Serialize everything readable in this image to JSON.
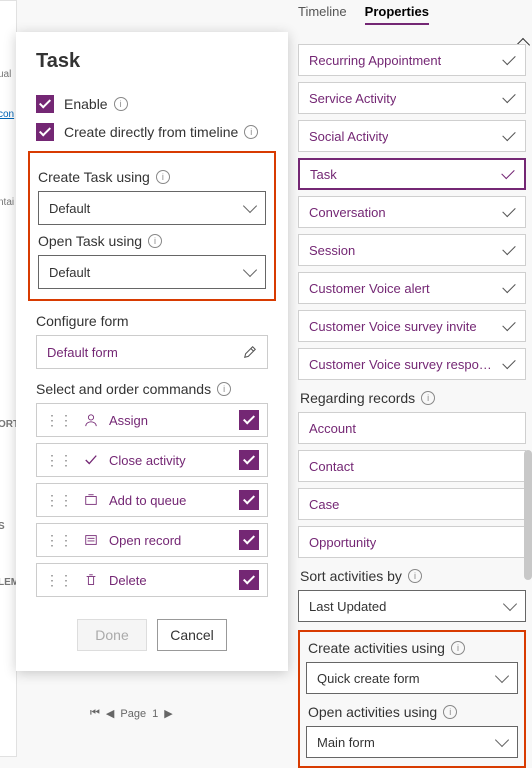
{
  "farLeft": {
    "a": "ual",
    "b": "con",
    "c": "ntai",
    "d": "ORTI",
    "e": "S",
    "f": "LEM"
  },
  "task": {
    "title": "Task",
    "enable_label": "Enable",
    "create_directly_label": "Create directly from timeline",
    "create_using_label": "Create Task using",
    "create_using_value": "Default",
    "open_using_label": "Open Task using",
    "open_using_value": "Default",
    "configure_form_label": "Configure form",
    "configure_form_value": "Default form",
    "commands_label": "Select and order commands",
    "cmds": [
      "Assign",
      "Close activity",
      "Add to queue",
      "Open record",
      "Delete"
    ],
    "done": "Done",
    "cancel": "Cancel"
  },
  "pager": {
    "label": "Page",
    "num": "1"
  },
  "tabs": {
    "timeline": "Timeline",
    "properties": "Properties"
  },
  "activities": [
    "Recurring Appointment",
    "Service Activity",
    "Social Activity",
    "Task",
    "Conversation",
    "Session",
    "Customer Voice alert",
    "Customer Voice survey invite",
    "Customer Voice survey response"
  ],
  "regarding": {
    "label": "Regarding records",
    "items": [
      "Account",
      "Contact",
      "Case",
      "Opportunity"
    ]
  },
  "sort": {
    "label": "Sort activities by",
    "value": "Last Updated"
  },
  "createAct": {
    "label": "Create activities using",
    "value": "Quick create form"
  },
  "openAct": {
    "label": "Open activities using",
    "value": "Main form"
  }
}
